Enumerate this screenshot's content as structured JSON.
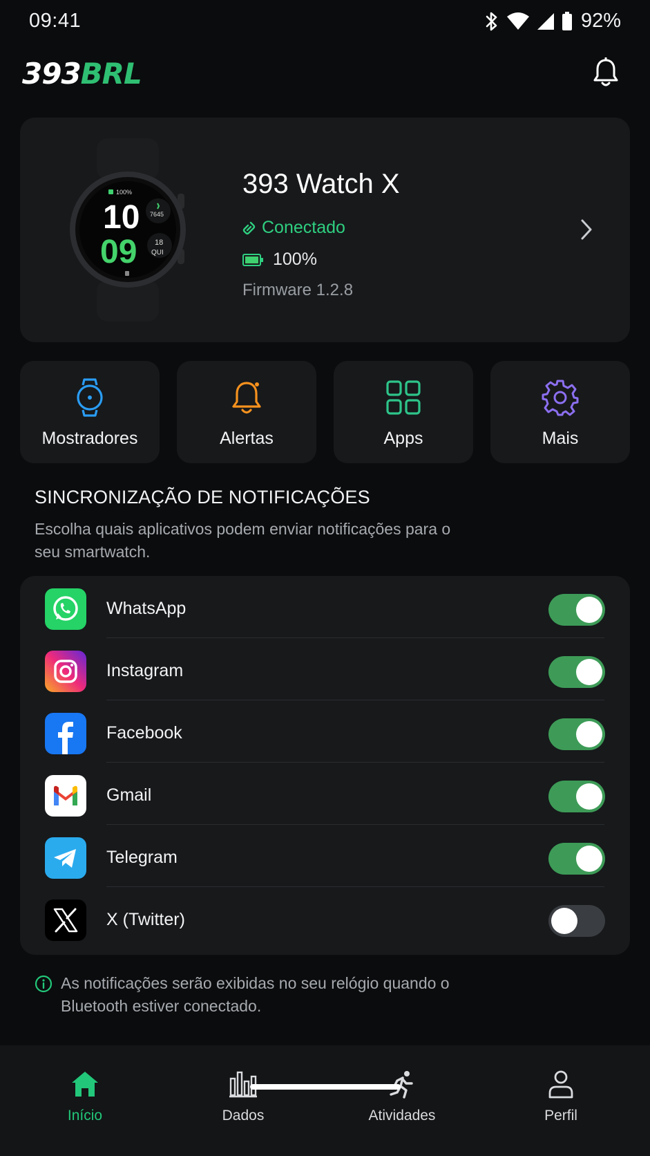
{
  "status_bar": {
    "time": "09:41",
    "battery": "92%"
  },
  "header": {
    "logo_primary": "393",
    "logo_accent": "BRL"
  },
  "device": {
    "name": "393 Watch X",
    "status": "Conectado",
    "battery": "100%",
    "firmware": "Firmware 1.2.8",
    "watchface": {
      "battery": "100%",
      "hour": "10",
      "minute": "09",
      "steps": "7645",
      "day": "18",
      "weekday": "QUI"
    }
  },
  "quick_actions": [
    {
      "label": "Mostradores",
      "icon": "watch-icon",
      "color": "#2a9df4"
    },
    {
      "label": "Alertas",
      "icon": "bell-icon",
      "color": "#f5911e"
    },
    {
      "label": "Apps",
      "icon": "apps-grid-icon",
      "color": "#2ec48a"
    },
    {
      "label": "Mais",
      "icon": "gear-icon",
      "color": "#8c6ff0"
    }
  ],
  "notifications": {
    "title": "SINCRONIZAÇÃO DE NOTIFICAÇÕES",
    "subtitle": "Escolha quais aplicativos podem enviar notificações para o seu smartwatch.",
    "apps": [
      {
        "name": "WhatsApp",
        "enabled": true
      },
      {
        "name": "Instagram",
        "enabled": true
      },
      {
        "name": "Facebook",
        "enabled": true
      },
      {
        "name": "Gmail",
        "enabled": true
      },
      {
        "name": "Telegram",
        "enabled": true
      },
      {
        "name": "X (Twitter)",
        "enabled": false
      }
    ],
    "info": "As notificações serão exibidas no seu relógio quando o Bluetooth estiver conectado."
  },
  "bottom_nav": [
    {
      "label": "Início",
      "active": true
    },
    {
      "label": "Dados",
      "active": false
    },
    {
      "label": "Atividades",
      "active": false
    },
    {
      "label": "Perfil",
      "active": false
    }
  ],
  "colors": {
    "accent": "#22c77a",
    "card": "#17191b",
    "background": "#0b0c0d",
    "toggle_on": "#3d9b57"
  }
}
